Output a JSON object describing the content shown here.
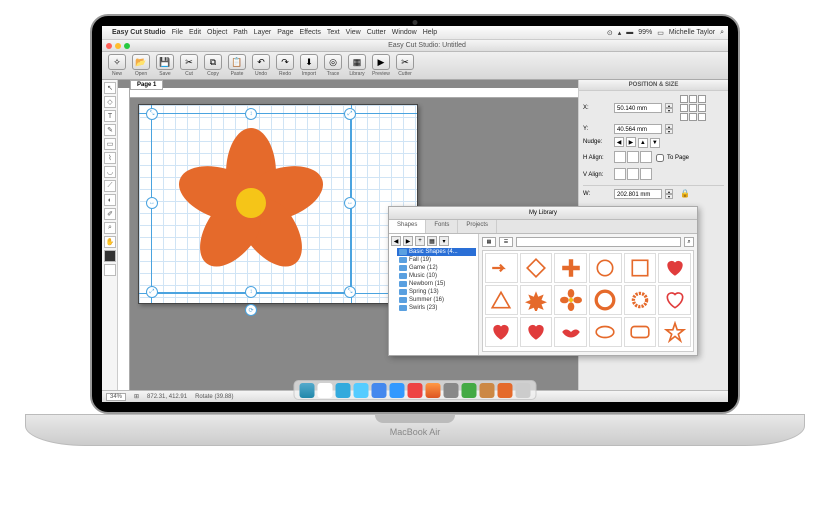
{
  "menubar": {
    "app": "Easy Cut Studio",
    "items": [
      "File",
      "Edit",
      "Object",
      "Path",
      "Layer",
      "Page",
      "Effects",
      "Text",
      "View",
      "Cutter",
      "Window",
      "Help"
    ],
    "battery": "99%",
    "user": "Michelle Taylor"
  },
  "window": {
    "title": "Easy Cut Studio: Untitled"
  },
  "toolbar": {
    "buttons": [
      "New",
      "Open",
      "Save",
      "Cut",
      "Copy",
      "Paste",
      "Undo",
      "Redo",
      "Import",
      "Trace",
      "Library",
      "Preview",
      "Cutter"
    ]
  },
  "page_tab": "Page 1",
  "panel": {
    "title": "POSITION & SIZE",
    "x_label": "X:",
    "x_value": "50.140 mm",
    "y_label": "Y:",
    "y_value": "40.564 mm",
    "nudge_label": "Nudge:",
    "halign_label": "H Align:",
    "valign_label": "V Align:",
    "to_page_label": "To Page",
    "w_label": "W:",
    "w_value": "202.801 mm"
  },
  "library": {
    "title": "My Library",
    "tabs": [
      "Shapes",
      "Fonts",
      "Projects"
    ],
    "folders": [
      {
        "name": "Basic Shapes (4...",
        "sel": true
      },
      {
        "name": "Fall (19)"
      },
      {
        "name": "Game (12)"
      },
      {
        "name": "Music (10)"
      },
      {
        "name": "Newborn (15)"
      },
      {
        "name": "Spring (13)"
      },
      {
        "name": "Summer (16)"
      },
      {
        "name": "Swirls (23)"
      }
    ]
  },
  "status": {
    "zoom": "34%",
    "coords": "872.31, 412.91",
    "action": "Rotate (39.88)"
  },
  "laptop_label": "MacBook Air"
}
